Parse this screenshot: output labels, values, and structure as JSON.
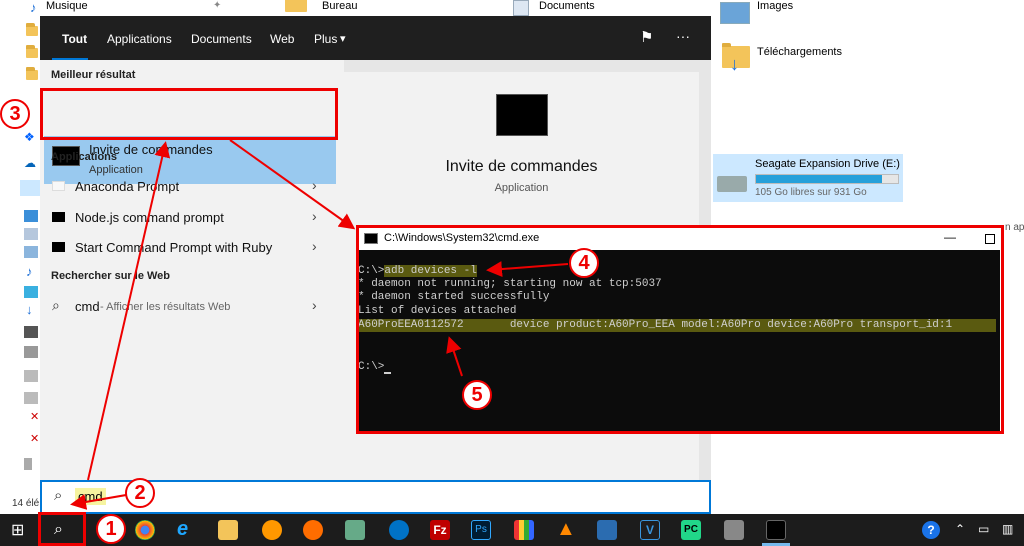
{
  "explorer": {
    "quick_access": {
      "music": "Musique"
    },
    "folders": {
      "desktop": "Bureau",
      "documents": "Documents",
      "images": "Images",
      "downloads": "Téléchargements"
    },
    "drive": {
      "name": "Seagate Expansion Drive (E:)",
      "free": "105 Go libres sur 931 Go",
      "used_fraction": 0.89
    },
    "status_items": "14 élé",
    "side_fragment": "n ap"
  },
  "start_menu": {
    "tabs": [
      "Tout",
      "Applications",
      "Documents",
      "Web",
      "Plus"
    ],
    "plus_chevron": "▾",
    "best_result_heading": "Meilleur résultat",
    "best_result": {
      "name": "Invite de commandes",
      "kind": "Application"
    },
    "apps_heading": "Applications",
    "apps": [
      "Anaconda Prompt",
      "Node.js command prompt",
      "Start Command Prompt with Ruby"
    ],
    "web_heading": "Rechercher sur le Web",
    "web_result": {
      "query": "cmd",
      "suffix": " - Afficher les résultats Web"
    },
    "preview": {
      "name": "Invite de commandes",
      "kind": "Application"
    },
    "more": "···",
    "chevron": "›"
  },
  "search": {
    "value": "cmd"
  },
  "cmd": {
    "title": "C:\\Windows\\System32\\cmd.exe",
    "prompt1": "C:\\>",
    "command": "adb devices -l",
    "line2": "* daemon not running; starting now at tcp:5037",
    "line3": "* daemon started successfully",
    "line4": "List of devices attached",
    "device_line": "A60ProEEA0112572       device product:A60Pro_EEA model:A60Pro device:A60Pro transport_id:1",
    "prompt2": "C:\\>"
  },
  "badges": [
    "1",
    "2",
    "3",
    "4",
    "5"
  ],
  "colors": {
    "accent": "#0078d7",
    "annotation": "#e00000",
    "highlight": "#99c9ef"
  }
}
